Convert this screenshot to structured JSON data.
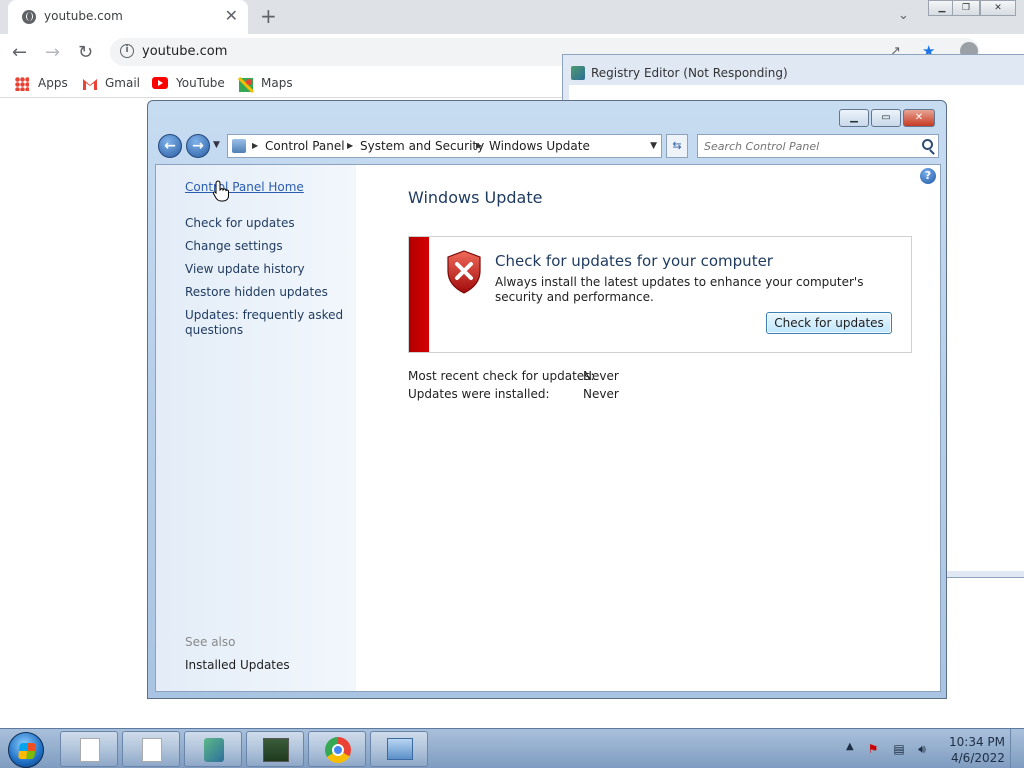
{
  "browser": {
    "tab_title": "youtube.com",
    "tab_close": "✕",
    "new_tab": "+",
    "url": "youtube.com",
    "bookmarks": [
      {
        "label": "Apps"
      },
      {
        "label": "Gmail"
      },
      {
        "label": "YouTube"
      },
      {
        "label": "Maps"
      }
    ]
  },
  "registry_editor": {
    "title": "Registry Editor (Not Responding)"
  },
  "control_panel": {
    "breadcrumb": [
      "Control Panel",
      "System and Security",
      "Windows Update"
    ],
    "search_placeholder": "Search Control Panel",
    "nav": {
      "home": "Control Panel Home",
      "links": [
        "Check for updates",
        "Change settings",
        "View update history",
        "Restore hidden updates",
        "Updates: frequently asked questions"
      ],
      "see_also_heading": "See also",
      "see_also_link": "Installed Updates"
    },
    "page_title": "Windows Update",
    "status": {
      "heading": "Check for updates for your computer",
      "description": "Always install the latest updates to enhance your computer's security and performance.",
      "button": "Check for updates",
      "accent_color": "#c40000"
    },
    "info": {
      "recent_check_label": "Most recent check for updates:",
      "recent_check_value": "Never",
      "installed_label": "Updates were installed:",
      "installed_value": "Never"
    }
  },
  "taskbar": {
    "time": "10:34 PM",
    "date": "4/6/2022",
    "apps": [
      {
        "icon": "blank-document-icon"
      },
      {
        "icon": "blank-document-icon"
      },
      {
        "icon": "registry-editor-icon"
      },
      {
        "icon": "system-monitor-icon"
      },
      {
        "icon": "chrome-icon"
      },
      {
        "icon": "control-panel-icon"
      }
    ]
  }
}
